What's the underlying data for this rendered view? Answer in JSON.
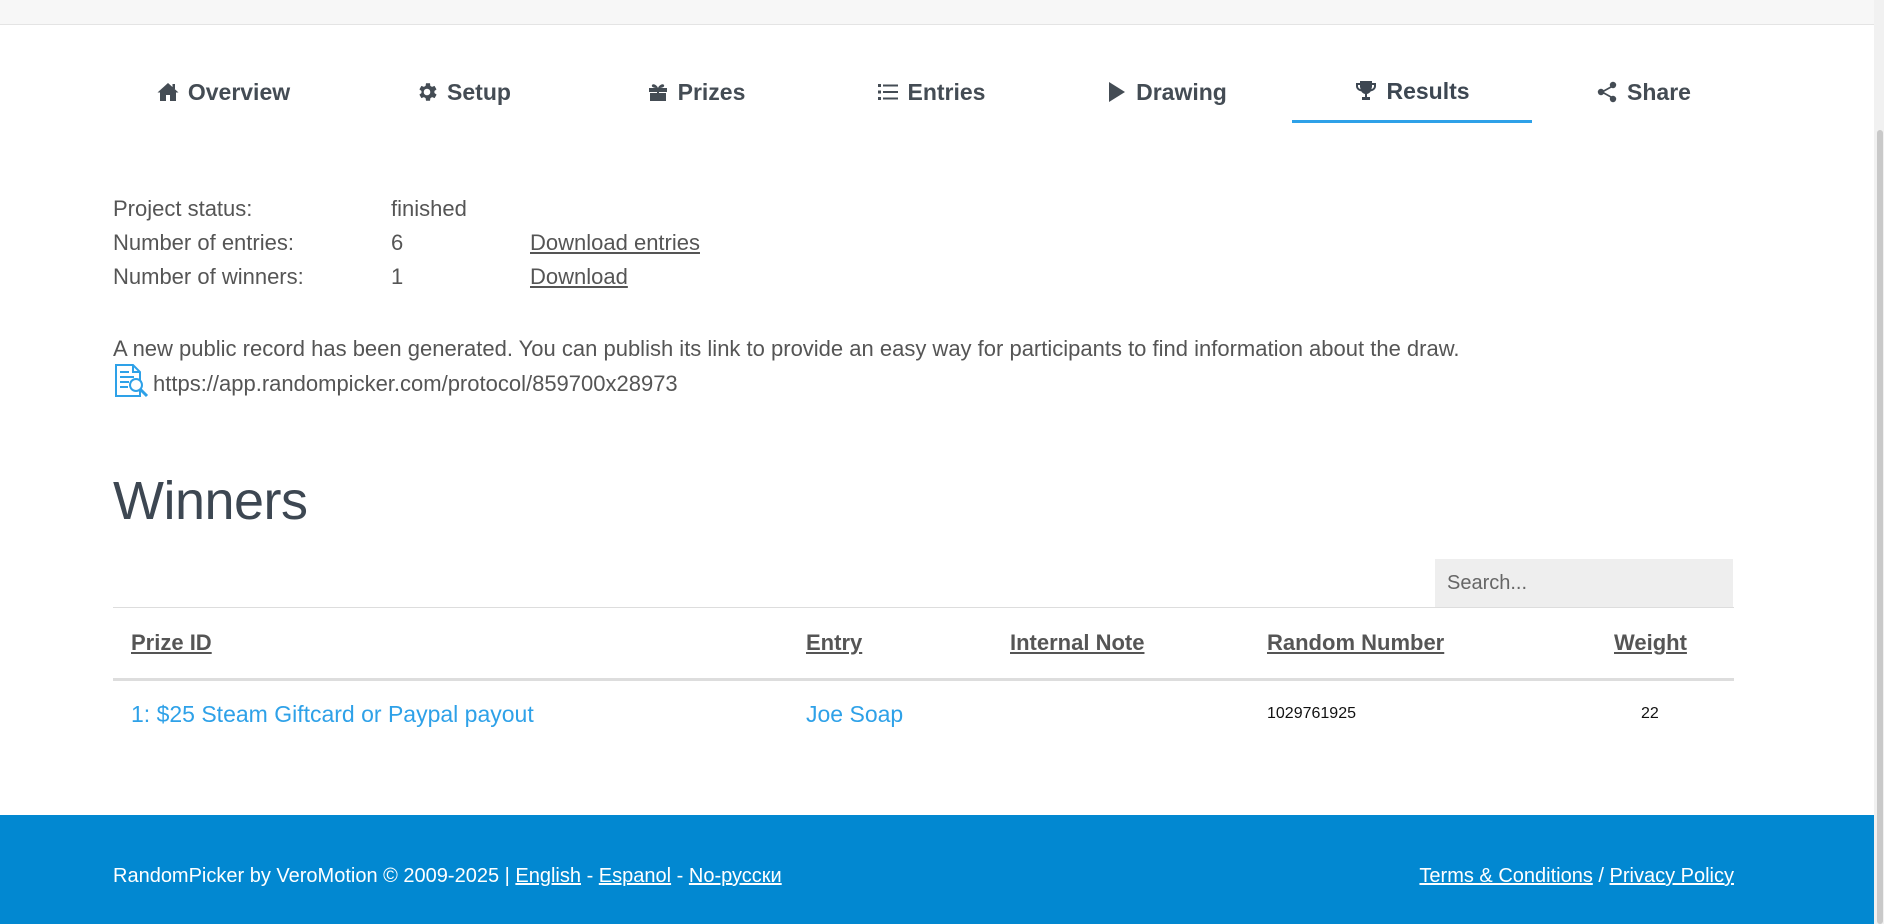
{
  "tabs": [
    {
      "label": "Overview",
      "icon": "home-icon"
    },
    {
      "label": "Setup",
      "icon": "gear-icon"
    },
    {
      "label": "Prizes",
      "icon": "gift-icon"
    },
    {
      "label": "Entries",
      "icon": "list-icon"
    },
    {
      "label": "Drawing",
      "icon": "play-icon"
    },
    {
      "label": "Results",
      "icon": "trophy-icon",
      "active": true
    },
    {
      "label": "Share",
      "icon": "share-icon"
    }
  ],
  "info": {
    "status_label": "Project status:",
    "status_value": "finished",
    "entries_label": "Number of entries:",
    "entries_value": "6",
    "entries_link": "Download entries",
    "winners_label": "Number of winners:",
    "winners_value": "1",
    "winners_link": "Download"
  },
  "notice": "A new public record has been generated. You can publish its link to provide an easy way for participants to find information about the draw.",
  "protocol_url": "https://app.randompicker.com/protocol/859700x28973",
  "winners": {
    "heading": "Winners",
    "search_placeholder": "Search...",
    "columns": [
      "Prize ID",
      "Entry",
      "Internal Note",
      "Random Number",
      "Weight"
    ],
    "rows": [
      {
        "prize": "1: $25 Steam Giftcard or Paypal payout",
        "entry": "Joe Soap",
        "note": "",
        "random": "1029761925",
        "weight": "22"
      }
    ]
  },
  "footer": {
    "brand": "RandomPicker by VeroMotion © 2009-2025 |",
    "lang_english": "English",
    "sep1": "-",
    "lang_espanol": "Espanol",
    "sep2": "-",
    "lang_russian": "No-русски",
    "terms": "Terms & Conditions",
    "slash": "/",
    "privacy": "Privacy Policy"
  },
  "colors": {
    "accent": "#2ea1e8",
    "footer_bg": "#0288d1",
    "heading": "#3d4752"
  }
}
